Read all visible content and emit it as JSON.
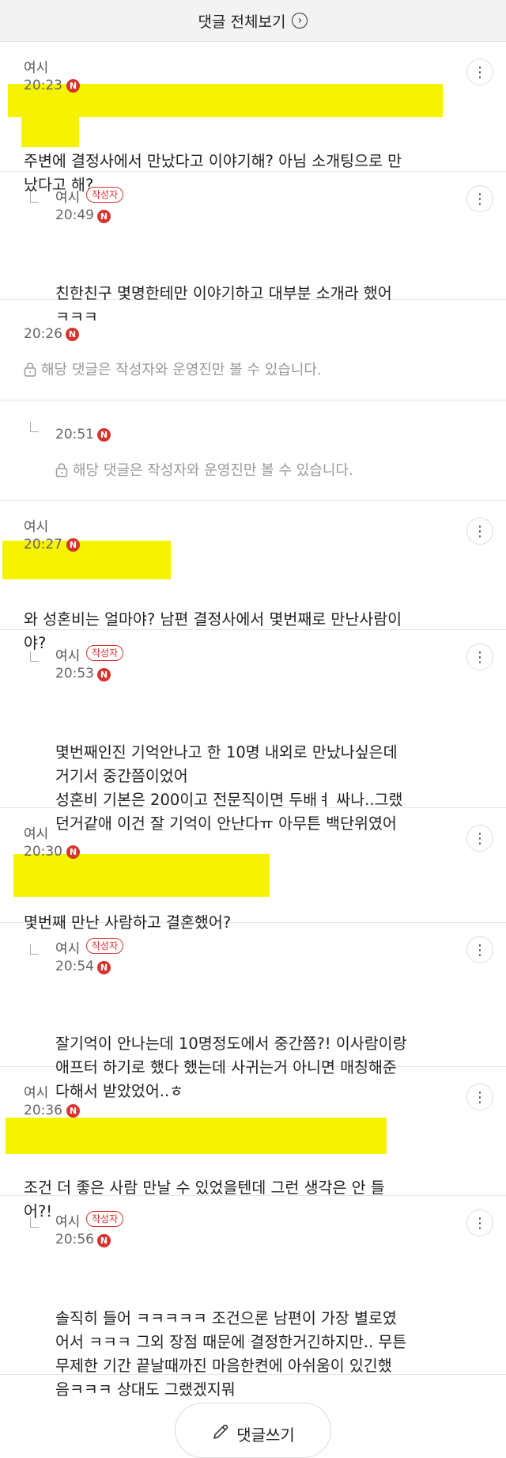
{
  "header": {
    "title": "댓글 전체보기",
    "icon": "chevron-right-circle-icon"
  },
  "badges": {
    "author": "작성자",
    "new": "N"
  },
  "comments": [
    {
      "author": "여시",
      "time": "20:23",
      "lines": [
        "주변에 결정사에서 만났다고 이야기해? 아님 소개팅으로 만",
        "났다고 해?"
      ]
    },
    {
      "author": "여시",
      "time": "20:49",
      "lines": [
        "친한친구 몇명한테만 이야기하고 대부분 소개라 했어",
        "ㅋㅋㅋ"
      ]
    },
    {
      "time": "20:26",
      "secret": "해당 댓글은 작성자와 운영진만 볼 수 있습니다."
    },
    {
      "time": "20:51",
      "secret": "해당 댓글은 작성자와 운영진만 볼 수 있습니다."
    },
    {
      "author": "여시",
      "time": "20:27",
      "lines": [
        "와 성혼비는 얼마야? 남편 결정사에서 몇번째로 만난사람이",
        "야?"
      ]
    },
    {
      "author": "여시",
      "time": "20:53",
      "lines": [
        "몇번째인진 기억안나고 한 10명 내외로 만났나싶은데",
        "거기서 중간쯤이었어",
        "성혼비 기본은 200이고 전문직이면 두배ㅕ 싸나..그랬",
        "던거같애 이건 잘 기억이 안난다ㅠ 아무튼 백단위였어"
      ]
    },
    {
      "author": "여시",
      "time": "20:30",
      "lines": [
        "몇번째 만난 사람하고 결혼했어?"
      ]
    },
    {
      "author": "여시",
      "time": "20:54",
      "lines": [
        "잘기억이 안나는데 10명정도에서 중간쯤?! 이사람이랑",
        "애프터 하기로 했다 했는데 사귀는거 아니면 매칭해준",
        "다해서 받았었어..ㅎ"
      ]
    },
    {
      "author": "여시",
      "time": "20:36",
      "lines": [
        "조건 더 좋은 사람 만날 수 있었을텐데 그런 생각은 안 들",
        "어?!"
      ]
    },
    {
      "author": "여시",
      "time": "20:56",
      "lines": [
        "솔직히 들어 ㅋㅋㅋㅋㅋ 조건으론 남편이 가장 별로였",
        "어서 ㅋㅋㅋ 그외 장점 때문에 결정한거긴하지만.. 무튼",
        "무제한 기간 끝날때까진 마음한켠에 아쉬움이 있긴했",
        "음ㅋㅋㅋ 상대도 그랬겠지뭐"
      ]
    }
  ],
  "footer": {
    "write_label": "댓글쓰기",
    "write_icon": "pencil-icon"
  },
  "colors": {
    "highlight": "#f6f300",
    "accent_red": "#d8342f"
  }
}
